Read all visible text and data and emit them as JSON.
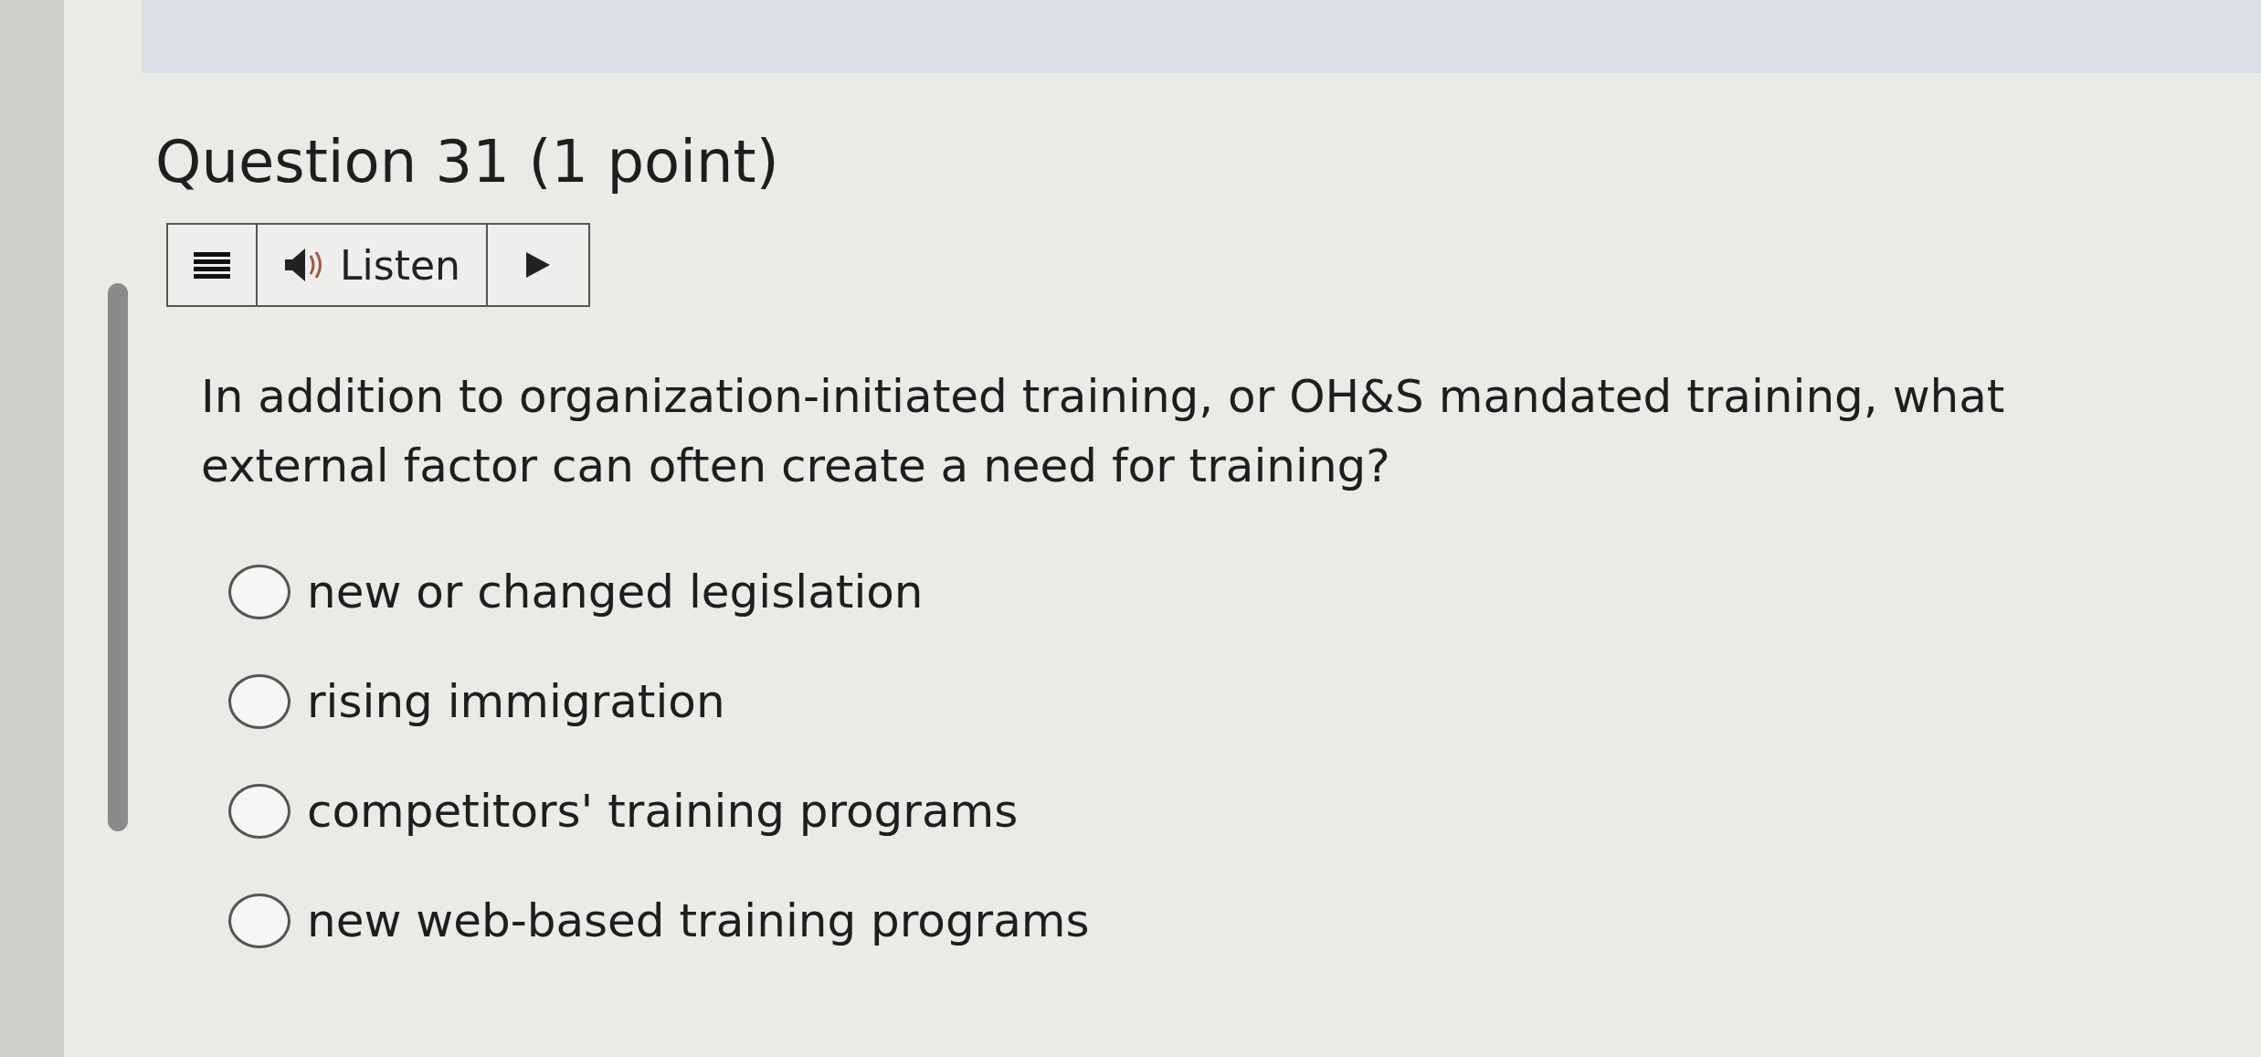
{
  "question": {
    "title": "Question 31 (1 point)",
    "text": "In addition to organization-initiated training, or OH&S mandated training, what external factor can often create a need for training?"
  },
  "toolbar": {
    "listen_label": "Listen"
  },
  "options": [
    {
      "label": "new or changed legislation",
      "selected": false
    },
    {
      "label": "rising immigration",
      "selected": false
    },
    {
      "label": "competitors' training programs",
      "selected": false
    },
    {
      "label": "new web-based training programs",
      "selected": false
    }
  ]
}
